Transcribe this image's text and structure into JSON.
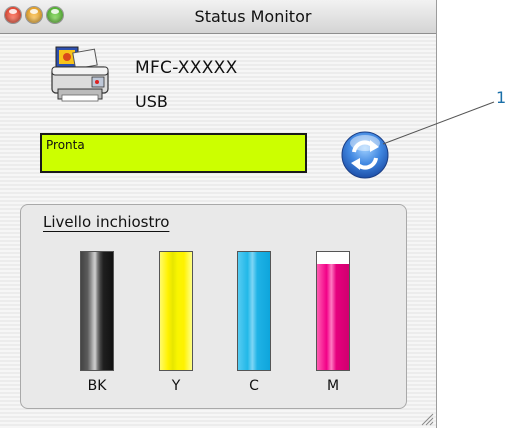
{
  "window": {
    "title": "Status Monitor"
  },
  "device": {
    "model": "MFC-XXXXX",
    "connection": "USB",
    "icon": "printer-icon"
  },
  "status": {
    "text": "Pronta",
    "color": "#ccff00"
  },
  "ink": {
    "group_label": "Livello inchiostro",
    "cartridges": [
      {
        "label": "BK",
        "level": 1.0,
        "color": "#1a1a1a"
      },
      {
        "label": "Y",
        "level": 1.0,
        "color": "#fff200"
      },
      {
        "label": "C",
        "level": 1.0,
        "color": "#22b8e8"
      },
      {
        "label": "M",
        "level": 0.9,
        "color": "#f20087"
      }
    ]
  },
  "callout": {
    "number": "1"
  }
}
